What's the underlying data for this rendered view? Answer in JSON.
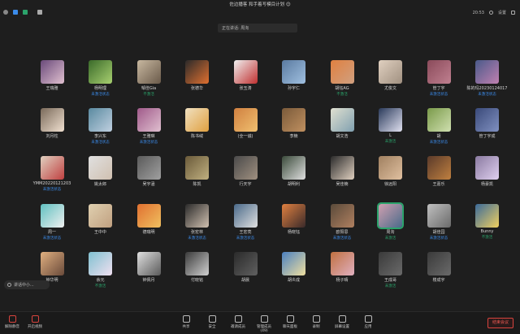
{
  "window": {
    "title": "佐边播客 和手着写模目计划 😊"
  },
  "status": {
    "time": "20:53",
    "settings_label": "设置"
  },
  "speaking": {
    "label": "正在讲话: 周洵"
  },
  "participants": [
    {
      "name": "王瑞雅",
      "status": "",
      "colors": [
        "#6a4a7a",
        "#e0c0d0"
      ]
    },
    {
      "name": "杨明理",
      "status": "未激活状态",
      "status_color": "#3b8bea",
      "colors": [
        "#3a6a2a",
        "#a8d070"
      ]
    },
    {
      "name": "邹佳Gia",
      "status": "不激活",
      "status_color": "#2ba36b",
      "colors": [
        "#c8b8a0",
        "#6a5a4a"
      ]
    },
    {
      "name": "张德华",
      "status": "",
      "colors": [
        "#2a2a2a",
        "#e07030"
      ]
    },
    {
      "name": "张玉涛",
      "status": "",
      "colors": [
        "#f0f0f0",
        "#c03030"
      ]
    },
    {
      "name": "孙宇仁",
      "status": "",
      "colors": [
        "#5a7aa0",
        "#a0c0e0"
      ]
    },
    {
      "name": "胡钰AG",
      "status": "不激活",
      "status_color": "#2ba36b",
      "colors": [
        "#e08040",
        "#d0a080"
      ]
    },
    {
      "name": "尤俊文",
      "status": "",
      "colors": [
        "#e0d0c0",
        "#a09080"
      ]
    },
    {
      "name": "管丁宇",
      "status": "未激活状态",
      "status_color": "#3b8bea",
      "colors": [
        "#8a4a5a",
        "#c08090"
      ]
    },
    {
      "name": "陈的玛20230124017",
      "status": "未激活状态",
      "status_color": "#3b8bea",
      "colors": [
        "#4a5a8a",
        "#c080b0"
      ]
    },
    {
      "name": "刘月柱",
      "status": "",
      "colors": [
        "#7a6a5a",
        "#f0e0d0"
      ]
    },
    {
      "name": "李兴东",
      "status": "未激活状态",
      "status_color": "#3b8bea",
      "colors": [
        "#5a8aa0",
        "#c0d0e0"
      ]
    },
    {
      "name": "王雅琳",
      "status": "未激活状态",
      "status_color": "#3b8bea",
      "colors": [
        "#a05a8a",
        "#e0c0d0"
      ]
    },
    {
      "name": "陈书绒",
      "status": "",
      "colors": [
        "#f0e0c0",
        "#e0a040"
      ]
    },
    {
      "name": "(全一诚)",
      "status": "",
      "colors": [
        "#d08040",
        "#f0c070"
      ]
    },
    {
      "name": "李楠",
      "status": "",
      "colors": [
        "#7a5a3a",
        "#c09060"
      ]
    },
    {
      "name": "胡文浩",
      "status": "",
      "colors": [
        "#e0e0d0",
        "#80a0b0"
      ]
    },
    {
      "name": "L",
      "status": "未激活",
      "status_color": "#2ba36b",
      "colors": [
        "#2a3a5a",
        "#e0e0f0"
      ]
    },
    {
      "name": "胡",
      "status": "未激活状态",
      "status_color": "#3b8bea",
      "colors": [
        "#7a9a4a",
        "#d0e0b0"
      ]
    },
    {
      "name": "管丁宇成",
      "status": "",
      "colors": [
        "#3a4a7a",
        "#8090c0"
      ]
    },
    {
      "name": "YMM20220121203",
      "status": "未激活状态",
      "status_color": "#3b8bea",
      "colors": [
        "#e0d0c0",
        "#c04040"
      ]
    },
    {
      "name": "姚太郎",
      "status": "",
      "colors": [
        "#e0e0e0",
        "#d0c0b0"
      ]
    },
    {
      "name": "吴宇涵",
      "status": "",
      "colors": [
        "#5a5a5a",
        "#a0a0a0"
      ]
    },
    {
      "name": "陈凯",
      "status": "",
      "colors": [
        "#6a5a3a",
        "#c0b080"
      ]
    },
    {
      "name": "行天宇",
      "status": "",
      "colors": [
        "#4a4a4a",
        "#a09080"
      ]
    },
    {
      "name": "胡明利",
      "status": "",
      "colors": [
        "#3a4a3a",
        "#e0e0e0"
      ]
    },
    {
      "name": "吴佳楠",
      "status": "",
      "colors": [
        "#2a2a2a",
        "#e0d0c0"
      ]
    },
    {
      "name": "徐远阳",
      "status": "",
      "colors": [
        "#a08060",
        "#e0c0a0"
      ]
    },
    {
      "name": "王嘉乐",
      "status": "",
      "colors": [
        "#5a3a2a",
        "#c08040"
      ]
    },
    {
      "name": "杨豪凯",
      "status": "",
      "colors": [
        "#8a7aa0",
        "#e0d0f0"
      ]
    },
    {
      "name": "周一",
      "status": "未激活状态",
      "status_color": "#3b8bea",
      "colors": [
        "#60c0c0",
        "#f0f0f0"
      ]
    },
    {
      "name": "王中中",
      "status": "",
      "colors": [
        "#e0d0b0",
        "#c0a080"
      ]
    },
    {
      "name": "德瑞明",
      "status": "",
      "colors": [
        "#e07030",
        "#f0c060"
      ]
    },
    {
      "name": "张宏林",
      "status": "未激活状态",
      "status_color": "#3b8bea",
      "colors": [
        "#2a2a2a",
        "#d0c0b0"
      ]
    },
    {
      "name": "王宏亮",
      "status": "未激活状态",
      "status_color": "#3b8bea",
      "colors": [
        "#4a6a8a",
        "#e0e0e0"
      ]
    },
    {
      "name": "杨晓钰",
      "status": "",
      "colors": [
        "#e08040",
        "#3a2a2a"
      ]
    },
    {
      "name": "欧阳思",
      "status": "未激活状态",
      "status_color": "#3b8bea",
      "colors": [
        "#5a4a3a",
        "#b08060"
      ]
    },
    {
      "name": "周洵",
      "status": "未激活",
      "status_color": "#2ba36b",
      "active": true,
      "colors": [
        "#d0a0b0",
        "#4a6a8a"
      ]
    },
    {
      "name": "胡佳园",
      "status": "未激活状态",
      "status_color": "#3b8bea",
      "colors": [
        "#c0c0c0",
        "#6a6a6a"
      ]
    },
    {
      "name": "Bunny",
      "status": "不激活",
      "status_color": "#2ba36b",
      "colors": [
        "#3a6a9a",
        "#f0d060"
      ]
    },
    {
      "name": "钟华明",
      "status": "",
      "colors": [
        "#e0b080",
        "#6a4a3a"
      ]
    },
    {
      "name": "余元",
      "status": "不激活",
      "status_color": "#2ba36b",
      "colors": [
        "#80c0d0",
        "#f0e0f0"
      ]
    },
    {
      "name": "钟佩月",
      "status": "",
      "colors": [
        "#e0e0e0",
        "#5a5a5a"
      ]
    },
    {
      "name": "付晓铭",
      "status": "",
      "colors": [
        "#3a3a3a",
        "#d0d0d0"
      ]
    },
    {
      "name": "胡晨",
      "status": "",
      "colors": [
        "#2a2a2a",
        "#606060"
      ]
    },
    {
      "name": "胡炎成",
      "status": "",
      "colors": [
        "#4a80c0",
        "#f0e0a0"
      ]
    },
    {
      "name": "杨子晴",
      "status": "",
      "colors": [
        "#c07040",
        "#e0b0c0"
      ]
    },
    {
      "name": "王成哥",
      "status": "未激活",
      "status_color": "#2ba36b",
      "colors": [
        "#3a3a3a",
        "#6a6a6a"
      ]
    },
    {
      "name": "楼成宇",
      "status": "",
      "colors": [
        "#3a3a3a",
        "#6a6a6a"
      ]
    }
  ],
  "toast": {
    "label": "讲话中小..."
  },
  "bottom_left": [
    {
      "label": "解除静音",
      "icon": "microphone-muted-icon"
    },
    {
      "label": "开启视频",
      "icon": "video-off-icon"
    }
  ],
  "bottom_center": [
    {
      "label": "共享",
      "icon": "share-screen-icon"
    },
    {
      "label": "安全",
      "icon": "shield-icon"
    },
    {
      "label": "邀请成员",
      "icon": "add-user-icon"
    },
    {
      "label": "管理成员(49)",
      "icon": "members-icon"
    },
    {
      "label": "聊天面板",
      "icon": "chat-icon"
    },
    {
      "label": "录制",
      "icon": "record-icon"
    },
    {
      "label": "屏幕设置",
      "icon": "layout-icon"
    },
    {
      "label": "应用",
      "icon": "apps-icon"
    }
  ],
  "end_button": {
    "label": "结束会议"
  }
}
